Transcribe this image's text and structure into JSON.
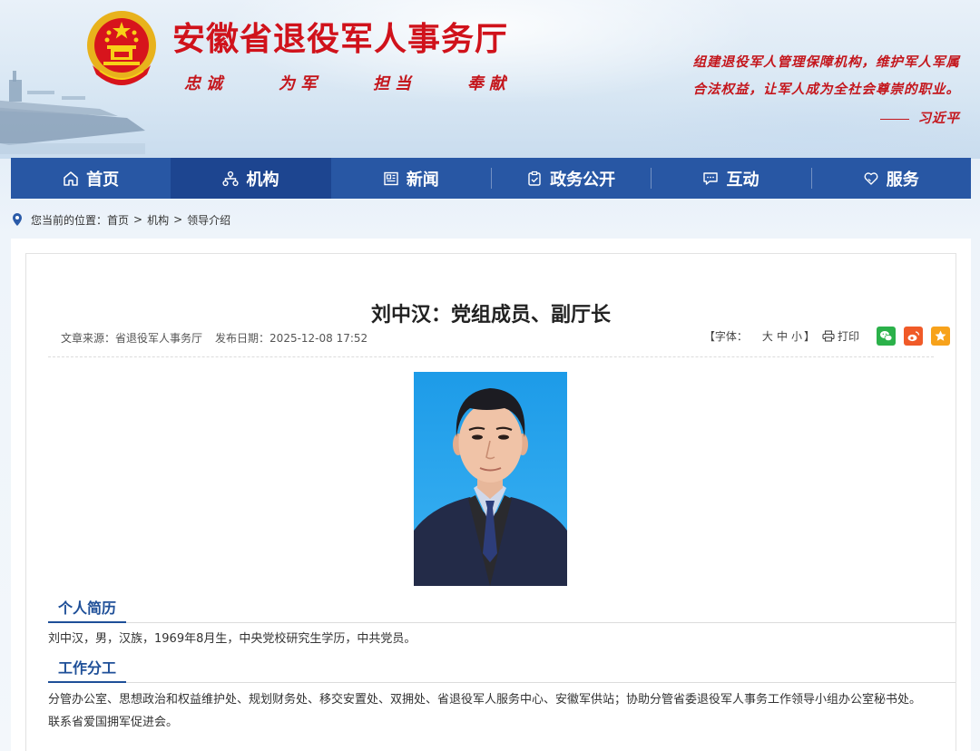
{
  "header": {
    "site_title": "安徽省退役军人事务厅",
    "mottos": [
      "忠诚",
      "为军",
      "担当",
      "奉献"
    ],
    "quote_line1": "组建退役军人管理保障机构，维护军人军属",
    "quote_line2": "合法权益，让军人成为全社会尊崇的职业。",
    "quote_author": "习近平"
  },
  "nav": {
    "items": [
      {
        "label": "首页",
        "icon": "home-icon"
      },
      {
        "label": "机构",
        "icon": "org-chart-icon"
      },
      {
        "label": "新闻",
        "icon": "newspaper-icon"
      },
      {
        "label": "政务公开",
        "icon": "clipboard-icon"
      },
      {
        "label": "互动",
        "icon": "chat-icon"
      },
      {
        "label": "服务",
        "icon": "heart-hands-icon"
      }
    ],
    "active_index": 1
  },
  "breadcrumb": {
    "prefix": "您当前的位置：",
    "items": [
      "首页",
      "机构",
      "领导介绍"
    ],
    "separator": ">"
  },
  "article": {
    "title": "刘中汉：党组成员、副厅长",
    "source_label": "文章来源：",
    "source": "省退役军人事务厅",
    "date_label": "发布日期：",
    "date": "2025-12-08 17:52",
    "font_bracket_open": "【",
    "font_label": "字体：",
    "font_sizes": [
      "大",
      "中",
      "小"
    ],
    "font_bracket_close": "】",
    "print_label": "打印",
    "share": [
      {
        "name": "wechat-icon",
        "color": "#2bb14a"
      },
      {
        "name": "weibo-icon",
        "color": "#f05a28"
      },
      {
        "name": "favorite-star-icon",
        "color": "#f7a21b"
      }
    ]
  },
  "sections": [
    {
      "heading": "个人简历",
      "text": "刘中汉，男，汉族，1969年8月生，中央党校研究生学历，中共党员。"
    },
    {
      "heading": "工作分工",
      "text_line1": "分管办公室、思想政治和权益维护处、规划财务处、移交安置处、双拥处、省退役军人服务中心、安徽军供站；协助分管省委退役军人事务工作领导小组办公室秘书处。",
      "text_line2": "联系省爱国拥军促进会。"
    }
  ],
  "colors": {
    "nav_bg": "#2857a4",
    "nav_active": "#1d4590",
    "brand_red": "#d0121b",
    "section_blue": "#1e4f98"
  }
}
